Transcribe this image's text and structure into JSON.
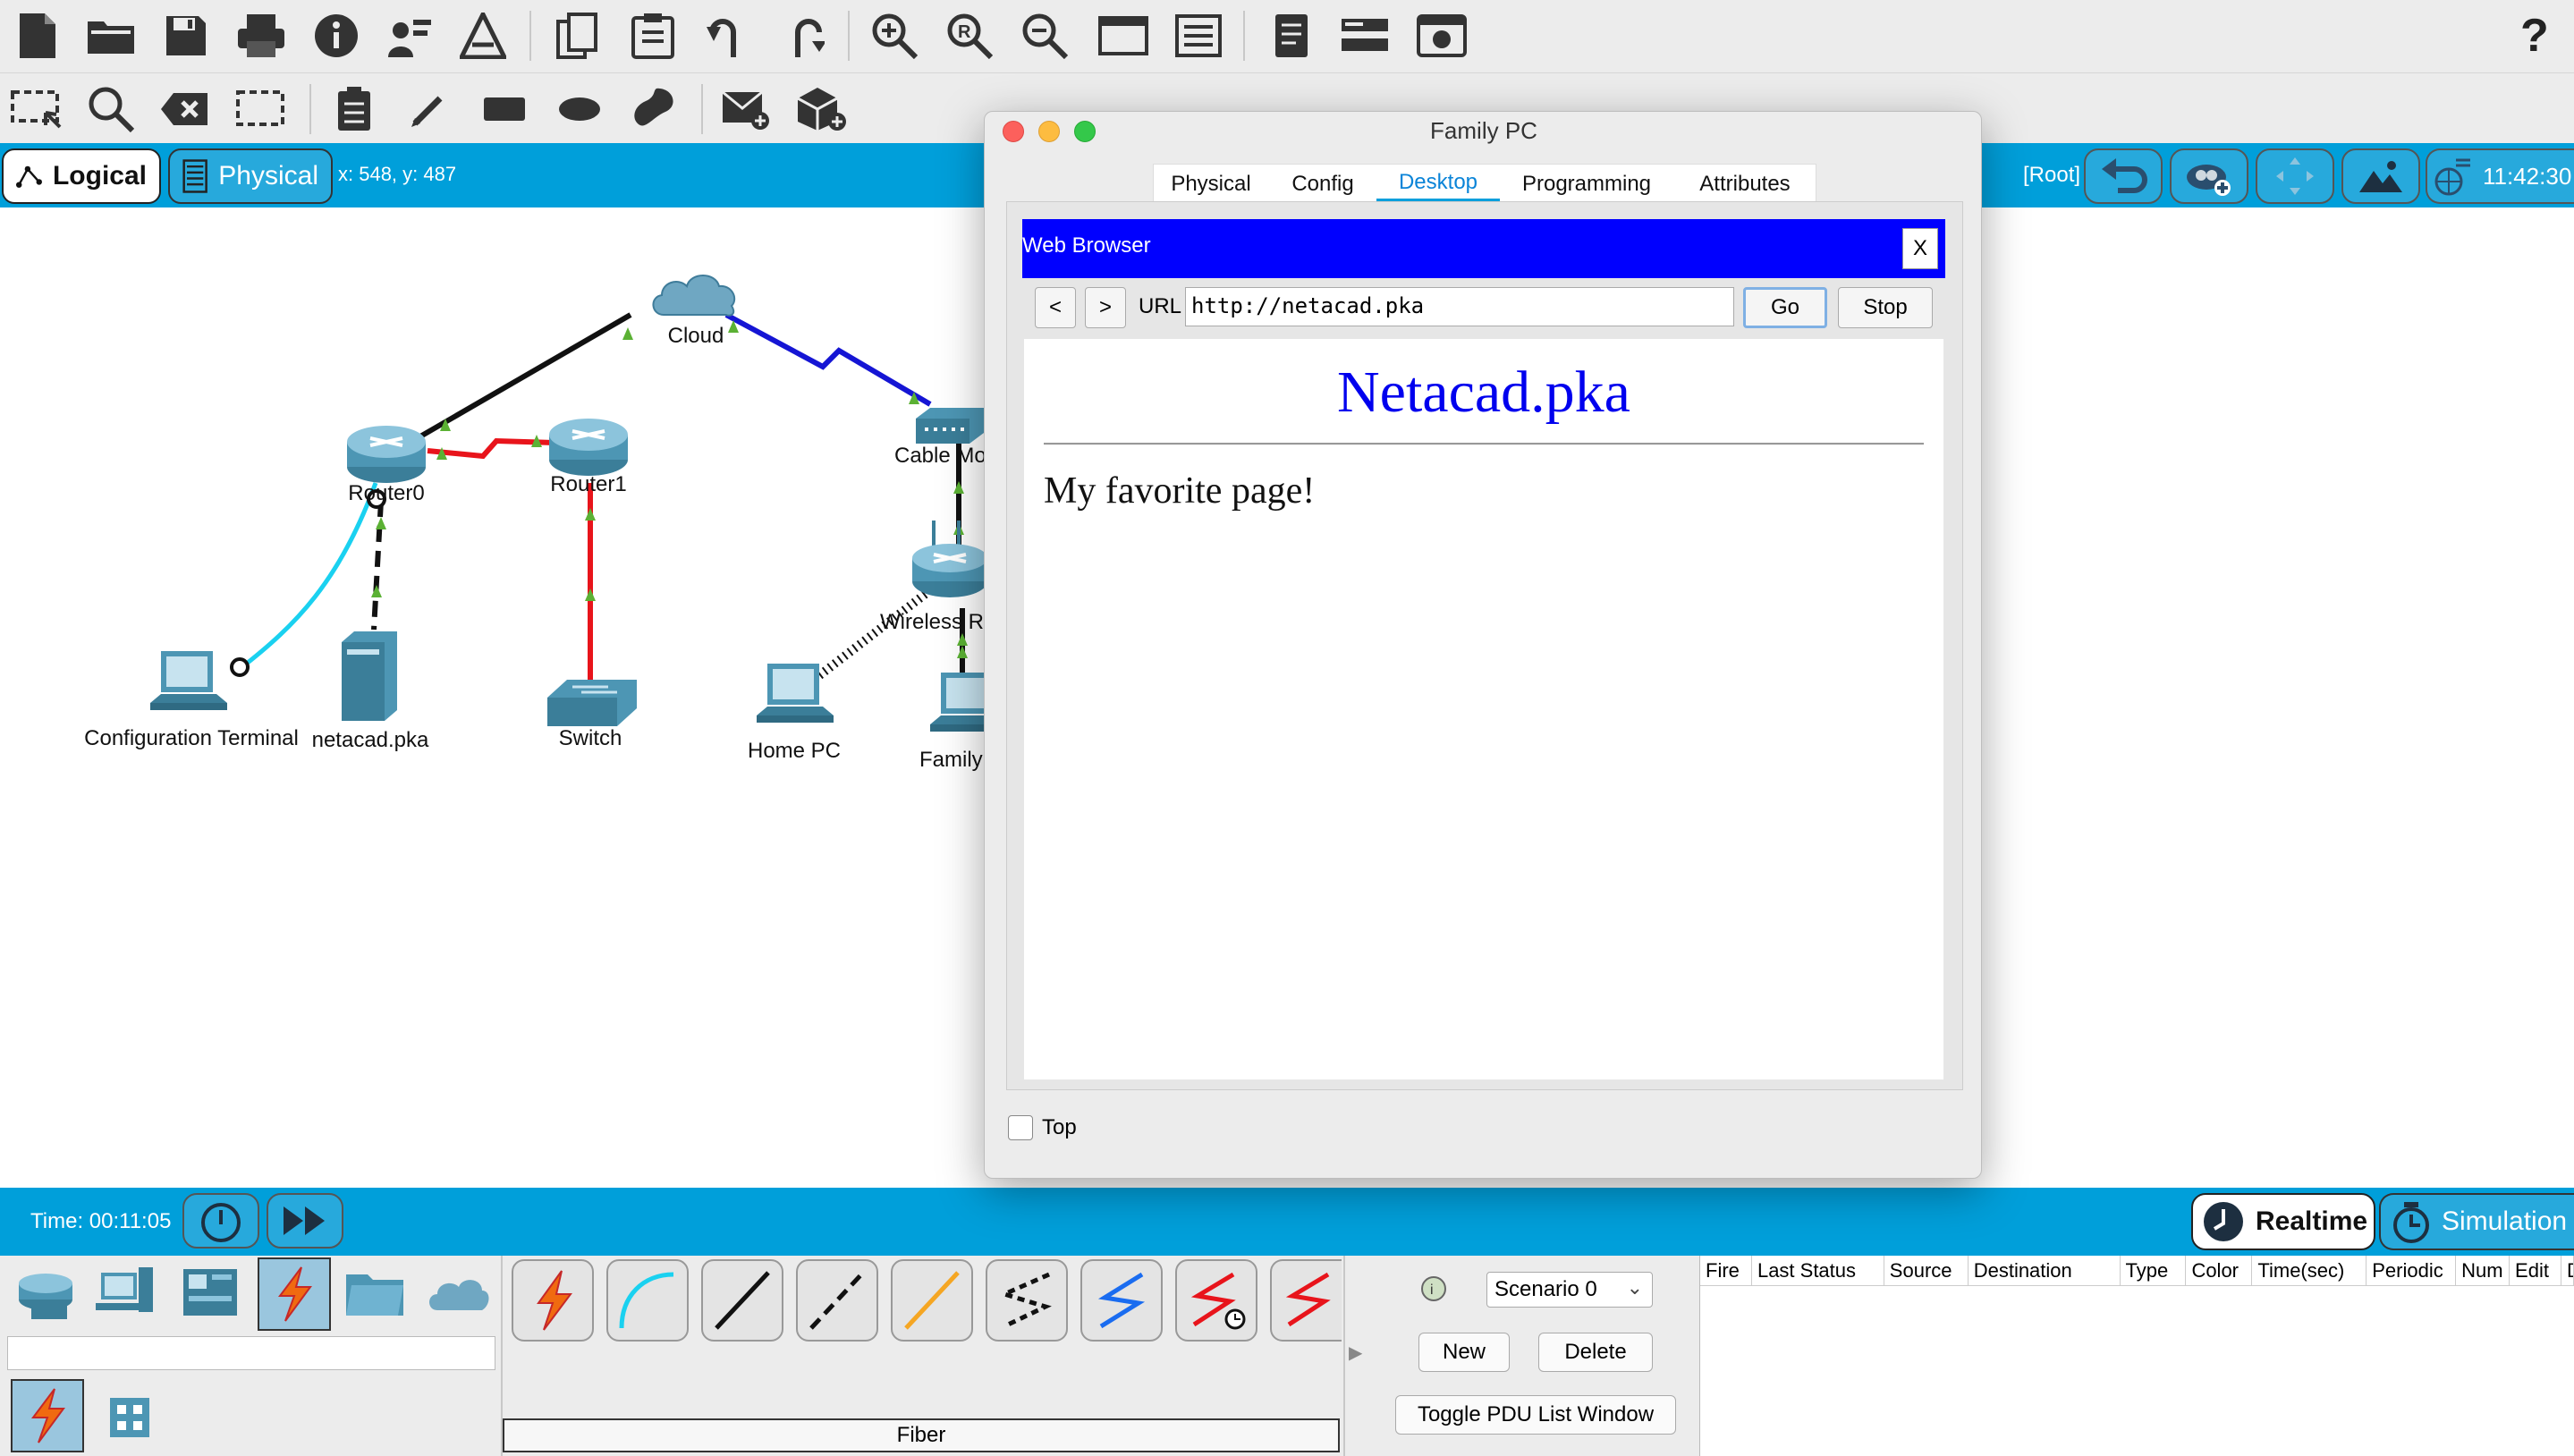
{
  "toolbar_top": {
    "icons": [
      "new-file-icon",
      "open-folder-icon",
      "save-icon",
      "print-icon",
      "info-icon",
      "activity-wizard-icon",
      "custom-device-icon",
      "copy-icon",
      "paste-icon",
      "undo-icon",
      "redo-icon",
      "zoom-in-icon",
      "zoom-reset-icon",
      "zoom-out-icon",
      "drawing-palette-icon",
      "custom-devices-dialog-icon",
      "pdu-list-icon",
      "view-command-log-icon",
      "screenshot-icon"
    ],
    "help_label": "?"
  },
  "toolbar_second": {
    "icons": [
      "select-icon",
      "inspect-icon",
      "delete-icon",
      "resize-icon",
      "note-icon",
      "pencil-icon",
      "rectangle-icon",
      "ellipse-icon",
      "freeform-icon",
      "simple-pdu-icon",
      "complex-pdu-icon"
    ]
  },
  "workspace": {
    "logical_label": "Logical",
    "physical_label": "Physical",
    "coordinates": "x: 548, y: 487",
    "root_label": "[Root]",
    "clock": "11:42:30"
  },
  "topology": {
    "devices": {
      "cloud": "Cloud",
      "router0": "Router0",
      "router1": "Router1",
      "cable_modem": "Cable Mo",
      "wireless_router": "Wireless Ro",
      "config_terminal": "Configuration Terminal",
      "server": "netacad.pka",
      "switch": "Switch",
      "home_pc": "Home PC",
      "family_pc": "Family"
    }
  },
  "dialog": {
    "title": "Family PC",
    "tabs": [
      "Physical",
      "Config",
      "Desktop",
      "Programming",
      "Attributes"
    ],
    "active_tab": "Desktop",
    "app_title": "Web Browser",
    "close_label": "X",
    "back_label": "<",
    "forward_label": ">",
    "url_label": "URL",
    "url_value": "http://netacad.pka",
    "go_label": "Go",
    "stop_label": "Stop",
    "page_heading": "Netacad.pka",
    "page_body": "My favorite page!",
    "top_checkbox_label": "Top",
    "top_checked": false
  },
  "bottom_bar": {
    "time": "Time: 00:11:05",
    "realtime_label": "Realtime",
    "simulation_label": "Simulation"
  },
  "bottom_panel": {
    "device_categories": [
      "network-devices-icon",
      "end-devices-icon",
      "components-icon",
      "connections-icon",
      "miscellaneous-icon",
      "multiuser-icon"
    ],
    "subcategory_icons": [
      "connections-subcategory-icon",
      "multiuser-grid-icon"
    ],
    "cables": [
      "automatic-cable-icon",
      "console-cable-icon",
      "copper-straight-through-icon",
      "copper-cross-over-icon",
      "fiber-cable-icon",
      "phone-cable-icon",
      "coaxial-cable-icon",
      "serial-dce-icon",
      "serial-dte-icon"
    ],
    "selected_cable_name": "Fiber",
    "scenario_value": "Scenario 0",
    "new_label": "New",
    "delete_label": "Delete",
    "toggle_pdu_label": "Toggle PDU List Window",
    "pdu_columns": [
      "Fire",
      "Last Status",
      "Source",
      "Destination",
      "Type",
      "Color",
      "Time(sec)",
      "Periodic",
      "Num",
      "Edit",
      "D"
    ]
  },
  "colors": {
    "accent_blue": "#009fda",
    "browser_bar": "#0000ff",
    "heading_blue": "#0000ee",
    "serial_red": "#e8141b",
    "console_cyan": "#1ad1f0",
    "link_green": "#5bb134"
  }
}
